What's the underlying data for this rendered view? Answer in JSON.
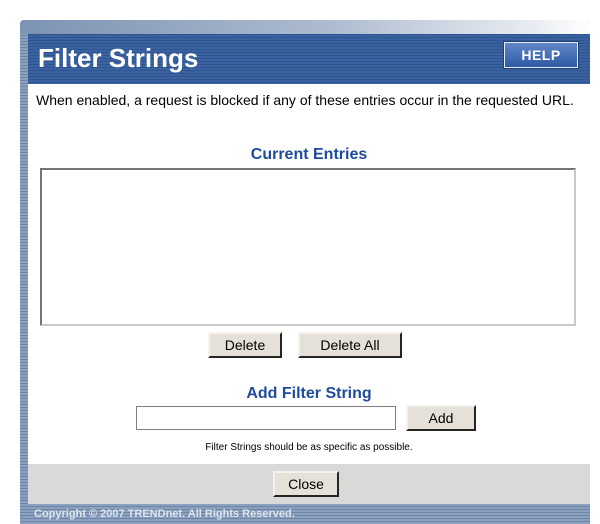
{
  "header": {
    "title": "Filter Strings",
    "help_label": "HELP"
  },
  "description": "When enabled, a request is blocked if any of these entries occur in the requested URL.",
  "current_entries": {
    "title": "Current Entries",
    "items": [],
    "delete_label": "Delete",
    "delete_all_label": "Delete All"
  },
  "add_filter": {
    "title": "Add Filter String",
    "input_value": "",
    "add_label": "Add",
    "hint": "Filter Strings should be as specific as possible."
  },
  "footer": {
    "close_label": "Close",
    "copyright": "Copyright © 2007 TRENDnet. All Rights Reserved."
  },
  "colors": {
    "header_bg": "#3a62a0",
    "section_title": "#1f4b9c",
    "button_bg": "#e5e1d8",
    "footer_bg": "#d9d9d9"
  }
}
